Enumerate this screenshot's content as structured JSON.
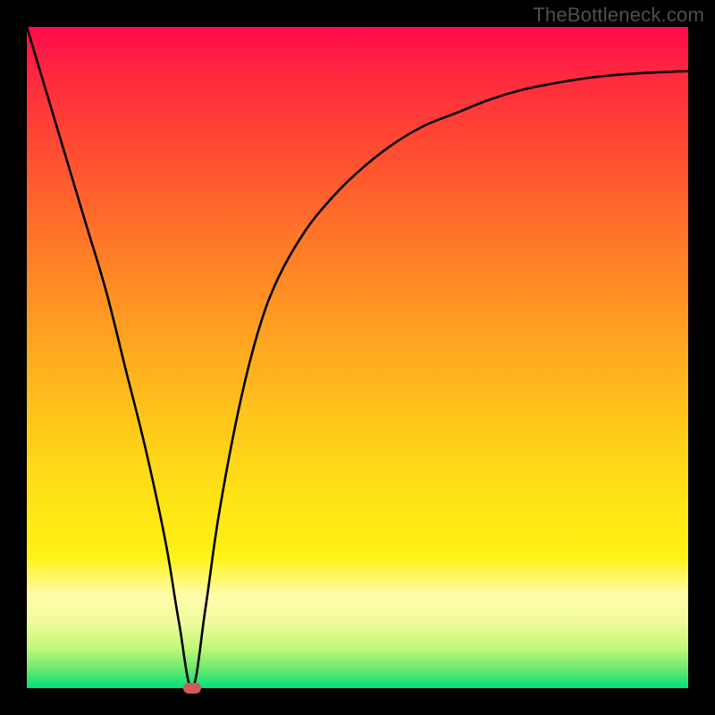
{
  "watermark": {
    "text": "TheBottleneck.com"
  },
  "chart_data": {
    "type": "line",
    "title": "",
    "xlabel": "",
    "ylabel": "",
    "xlim": [
      0,
      100
    ],
    "ylim": [
      0,
      100
    ],
    "grid": false,
    "legend": false,
    "min_point": {
      "x": 25,
      "y": 0,
      "color": "#d45a56"
    },
    "gradient_stops": [
      {
        "pos": 0,
        "color": "#ff0b4b"
      },
      {
        "pos": 20,
        "color": "#ff5131"
      },
      {
        "pos": 46,
        "color": "#ffa021"
      },
      {
        "pos": 70,
        "color": "#ffe016"
      },
      {
        "pos": 86,
        "color": "#fffcae"
      },
      {
        "pos": 100,
        "color": "#00e07a"
      }
    ],
    "series": [
      {
        "name": "bottleneck-curve",
        "x": [
          0,
          3,
          6,
          9,
          12,
          15,
          18,
          21,
          23,
          25,
          27,
          29,
          32,
          35,
          38,
          42,
          46,
          50,
          55,
          60,
          65,
          70,
          75,
          80,
          85,
          90,
          95,
          100
        ],
        "values": [
          100,
          90,
          80,
          70,
          60,
          48,
          36,
          22,
          10,
          0,
          12,
          26,
          42,
          54,
          62,
          69,
          74,
          78,
          82,
          85,
          87,
          89,
          90.5,
          91.5,
          92.3,
          92.8,
          93.1,
          93.3
        ]
      }
    ]
  }
}
